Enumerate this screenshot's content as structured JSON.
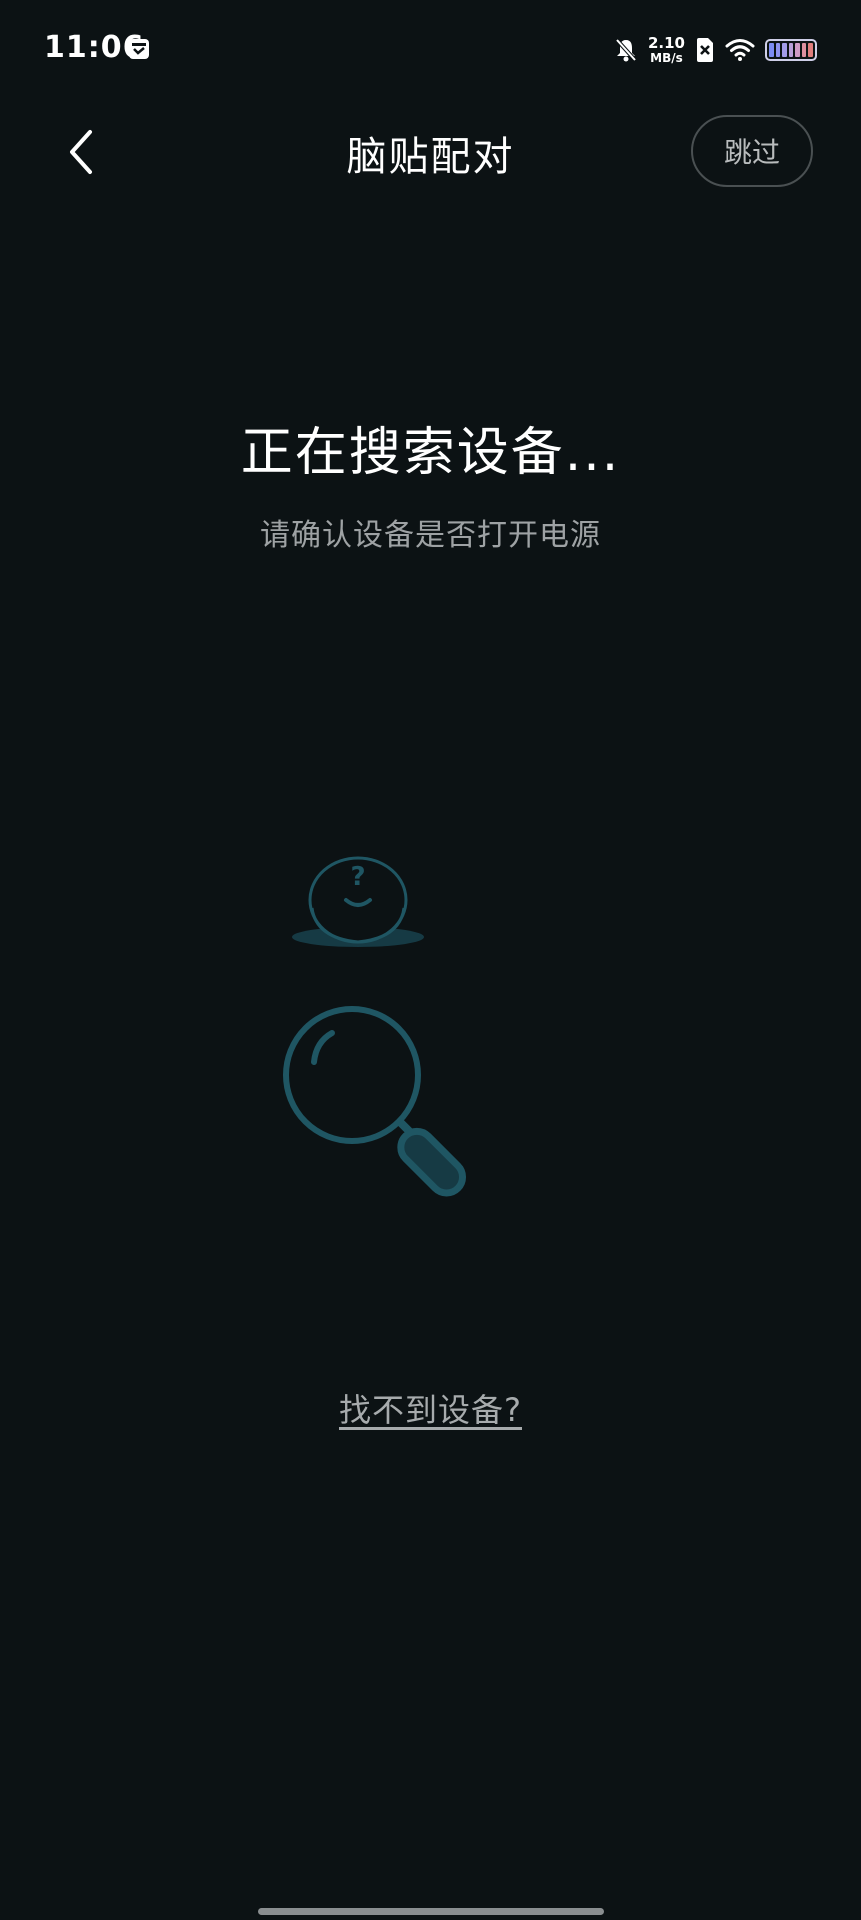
{
  "status_bar": {
    "time": "11:06",
    "net_speed_value": "2.10",
    "net_speed_unit": "MB/s",
    "battery_cell_colors": [
      "#7d8cf3",
      "#8f93f0",
      "#a39be8",
      "#b99fd8",
      "#cf9bc4",
      "#dd8f9f",
      "#e07d7d"
    ]
  },
  "header": {
    "title": "脑贴配对",
    "skip_label": "跳过"
  },
  "main": {
    "searching_title": "正在搜索设备...",
    "searching_subtitle": "请确认设备是否打开电源",
    "device_symbol": "?",
    "cant_find_link": "找不到设备?"
  },
  "colors": {
    "background": "#0c1214",
    "illustration_stroke": "#1f5663",
    "illustration_fill": "#163a44"
  },
  "icons": {
    "back": "chevron-left-icon",
    "mute": "bell-off-icon",
    "wifi": "wifi-icon",
    "sim": "sim-x-icon",
    "app": "app-notification-icon"
  }
}
